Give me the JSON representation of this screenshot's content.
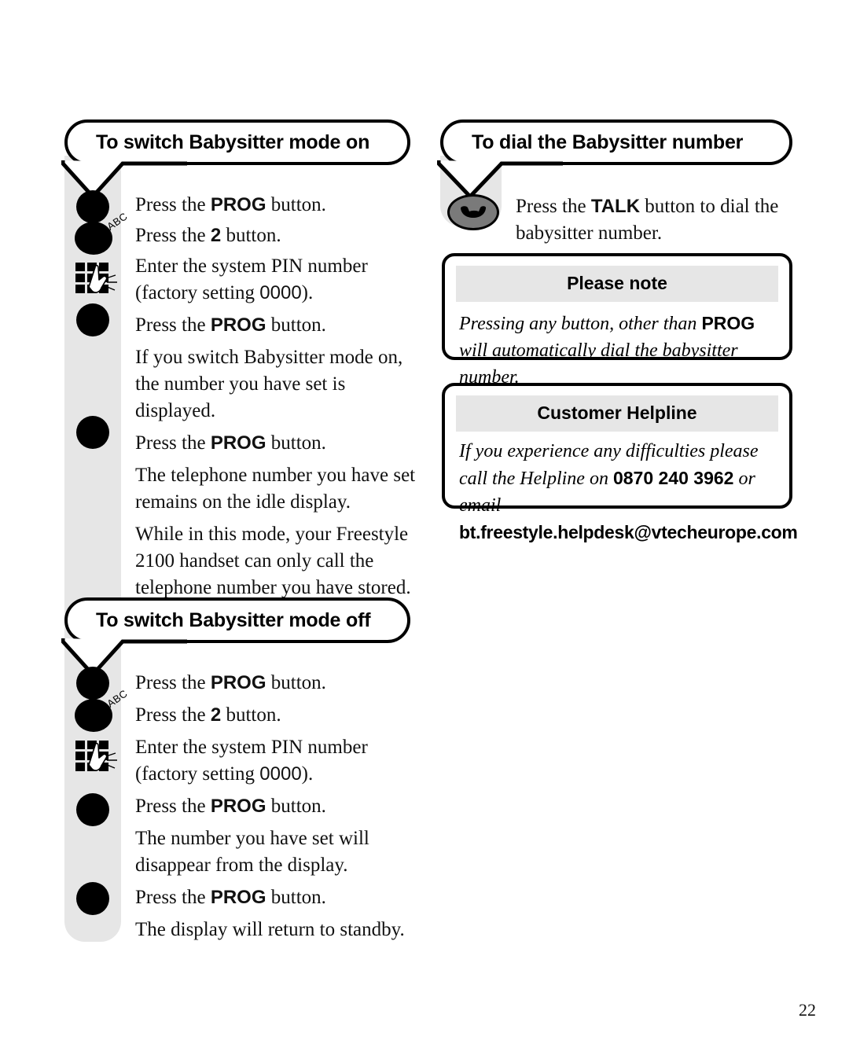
{
  "page": {
    "number": "22"
  },
  "sections": {
    "babysitter_on": {
      "title": "To switch Babysitter mode on",
      "steps": [
        {
          "icon": "prog-button-icon",
          "text_before": "Press the ",
          "keyword": "PROG",
          "text_after": " button."
        },
        {
          "icon": "key-2-abc-button-icon",
          "text_before": "Press the ",
          "keyword": "2",
          "text_after": " button."
        },
        {
          "icon": "keypad-icon",
          "line1": "Enter the system PIN number",
          "line2_before": "(factory setting ",
          "line2_value": "0000",
          "line2_after": ")."
        },
        {
          "icon": "prog-button-icon",
          "text_before": "Press the ",
          "keyword": "PROG",
          "text_after": " button."
        },
        {
          "icon": "none",
          "text": "If you switch Babysitter mode on, the number you have set is displayed."
        },
        {
          "icon": "prog-button-icon",
          "text_before": "Press the ",
          "keyword": "PROG",
          "text_after": " button."
        },
        {
          "icon": "none",
          "text": "The telephone number you have set remains on the idle display."
        },
        {
          "icon": "none",
          "text": "While in this mode, your Freestyle 2100 handset can only call the telephone number you have stored."
        }
      ]
    },
    "babysitter_off": {
      "title": "To switch Babysitter mode off",
      "steps": [
        {
          "icon": "prog-button-icon",
          "text_before": "Press the ",
          "keyword": "PROG",
          "text_after": " button."
        },
        {
          "icon": "key-2-abc-button-icon",
          "text_before": "Press the ",
          "keyword": "2",
          "text_after": " button."
        },
        {
          "icon": "keypad-icon",
          "line1": "Enter the system PIN number",
          "line2_before": "(factory setting ",
          "line2_value": "0000",
          "line2_after": ")."
        },
        {
          "icon": "prog-button-icon",
          "text_before": "Press the ",
          "keyword": "PROG",
          "text_after": " button."
        },
        {
          "icon": "none",
          "text": "The number you have set will disappear from the display."
        },
        {
          "icon": "prog-button-icon",
          "text_before": "Press the ",
          "keyword": "PROG",
          "text_after": " button."
        },
        {
          "icon": "none",
          "text": "The display will return to standby."
        }
      ]
    },
    "dial_babysitter": {
      "title": "To dial the Babysitter number",
      "step": {
        "icon": "talk-button-icon",
        "text_before": "Press the ",
        "keyword": "TALK",
        "text_after": " button to dial the babysitter number."
      }
    }
  },
  "notes": {
    "please_note": {
      "header": "Please note",
      "body_before": "Pressing any button, other than ",
      "keyword": "PROG",
      "body_after": " will automatically dial the babysitter number."
    },
    "customer_helpline": {
      "header": "Customer Helpline",
      "body_before": "If you experience any difficulties please call the Helpline on ",
      "phone": "0870 240 3962",
      "body_mid": " or email",
      "email": "bt.freestyle.helpdesk@vtecheurope.com"
    }
  },
  "icon_labels": {
    "abc": "ABC"
  },
  "colors": {
    "rail_gray": "#e6e6e6",
    "header_bar_gray": "#e6e6e6",
    "talk_button_gray": "#7a7a7a",
    "ink": "#000000"
  }
}
